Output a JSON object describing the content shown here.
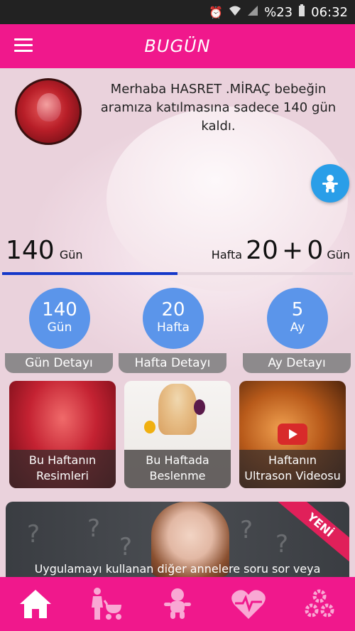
{
  "status_bar": {
    "battery": "%23",
    "time": "06:32"
  },
  "app_bar": {
    "title": "BUGÜN"
  },
  "greeting": {
    "text": "Merhaba HASRET .MİRAÇ bebeğin aramıza katılmasına sadece 140 gün kaldı."
  },
  "counters": {
    "days_value": "140",
    "days_unit": "Gün",
    "week_label": "Hafta",
    "week_value": "20",
    "plus": "+",
    "extra_days_value": "0",
    "extra_days_unit": "Gün",
    "progress_fraction": 0.5
  },
  "detail_cards": [
    {
      "number": "140",
      "unit": "Gün",
      "label": "Gün Detayı"
    },
    {
      "number": "20",
      "unit": "Hafta",
      "label": "Hafta Detayı"
    },
    {
      "number": "5",
      "unit": "Ay",
      "label": "Ay Detayı"
    }
  ],
  "image_cards": [
    {
      "line1": "Bu Haftanın",
      "line2": "Resimleri"
    },
    {
      "line1": "Bu Haftada",
      "line2": "Beslenme"
    },
    {
      "line1": "Haftanın",
      "line2": "Ultrason Videosu"
    }
  ],
  "banner": {
    "ribbon": "YENİ",
    "text": "Uygulamayı kullanan diğer annelere soru sor veya"
  },
  "bottom_nav": [
    "home-icon",
    "mother-stroller-icon",
    "baby-icon",
    "heart-rate-icon",
    "settings-gears-icon"
  ],
  "colors": {
    "primary": "#f0188c",
    "circle_blue": "#5b95ea",
    "fab_blue": "#2a9ee8",
    "progress": "#1538c9",
    "ribbon": "#e0205a"
  }
}
